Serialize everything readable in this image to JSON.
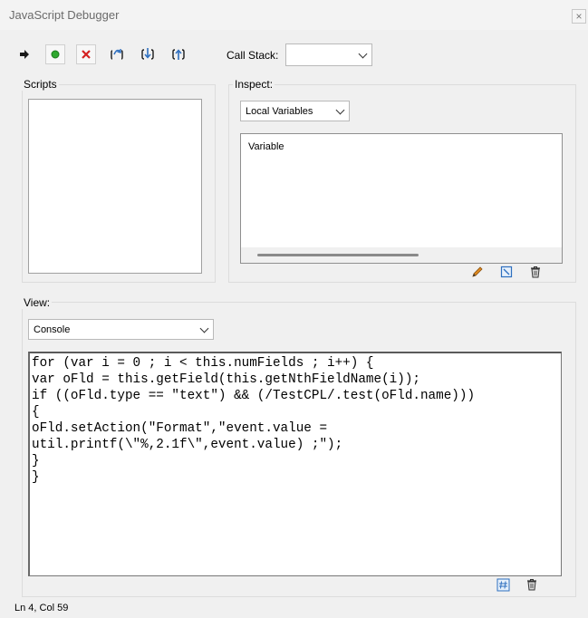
{
  "window": {
    "title": "JavaScript Debugger",
    "close_glyph": "×"
  },
  "toolbar": {
    "buttons": [
      {
        "name": "resume",
        "icon": "arrow-right-icon"
      },
      {
        "name": "interrupt",
        "icon": "green-dot-icon"
      },
      {
        "name": "quit",
        "icon": "red-x-icon"
      },
      {
        "name": "step-over",
        "icon": "step-over-icon"
      },
      {
        "name": "step-into",
        "icon": "step-into-icon"
      },
      {
        "name": "step-out",
        "icon": "step-out-icon"
      }
    ],
    "call_stack_label": "Call Stack:",
    "call_stack_value": ""
  },
  "scripts": {
    "label": "Scripts"
  },
  "inspect": {
    "label": "Inspect:",
    "dropdown_value": "Local Variables",
    "column_header": "Variable",
    "actions": [
      "edit-pencil-icon",
      "new-watch-icon",
      "delete-trash-icon"
    ]
  },
  "view": {
    "label": "View:",
    "dropdown_value": "Console",
    "code": "for (var i = 0 ; i < this.numFields ; i++) {\nvar oFld = this.getField(this.getNthFieldName(i));\nif ((oFld.type == \"text\") && (/TestCPL/.test(oFld.name)))\n{\noFld.setAction(\"Format\",\"event.value =\nutil.printf(\\\"%,2.1f\\\",event.value) ;\");\n}\n}",
    "actions": [
      "line-number-icon",
      "clear-trash-icon"
    ]
  },
  "status": {
    "text": "Ln 4, Col 59"
  },
  "colors": {
    "accent_blue": "#2e6fbf",
    "go_green": "#2fa82f",
    "stop_red": "#d42020"
  }
}
